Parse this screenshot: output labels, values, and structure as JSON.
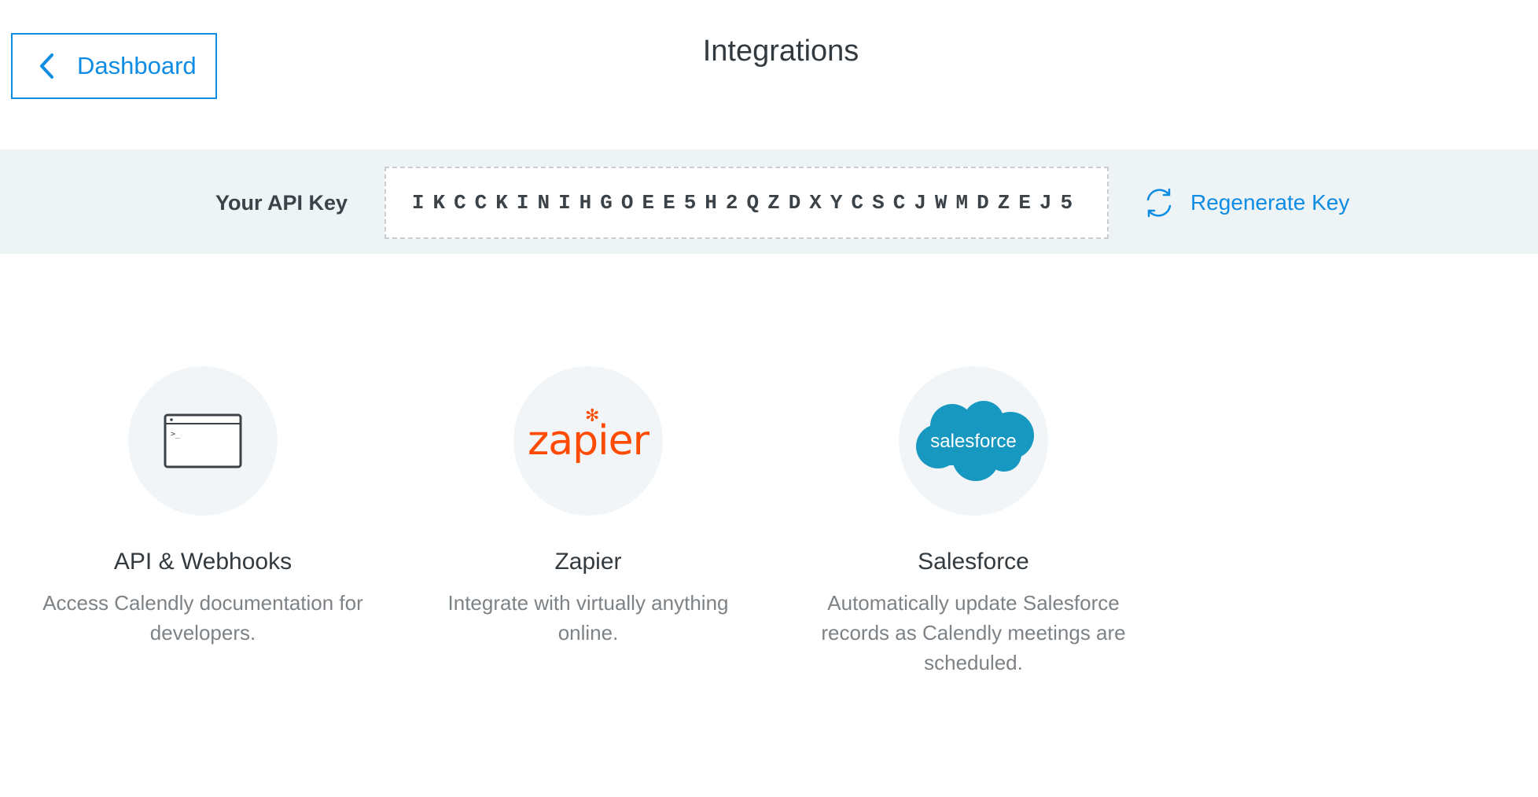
{
  "header": {
    "back_label": "Dashboard",
    "title": "Integrations"
  },
  "api_key": {
    "label": "Your API Key",
    "value": "IKCCKINIHGOEE5H2QZDXYCSCJWMDZEJ5",
    "regenerate_label": "Regenerate Key"
  },
  "integrations": [
    {
      "name": "API & Webhooks",
      "description": "Access Calendly documentation for developers.",
      "icon": "terminal-window-icon"
    },
    {
      "name": "Zapier",
      "description": "Integrate with virtually anything online.",
      "icon": "zapier-logo",
      "logo_text": "zapier"
    },
    {
      "name": "Salesforce",
      "description": "Automatically update Salesforce records as Calendly meetings are scheduled.",
      "icon": "salesforce-logo",
      "logo_text": "salesforce"
    }
  ],
  "colors": {
    "accent": "#0e8ce4",
    "band": "#eef3f6",
    "zapier": "#ff4a00",
    "salesforce": "#1798c1"
  }
}
